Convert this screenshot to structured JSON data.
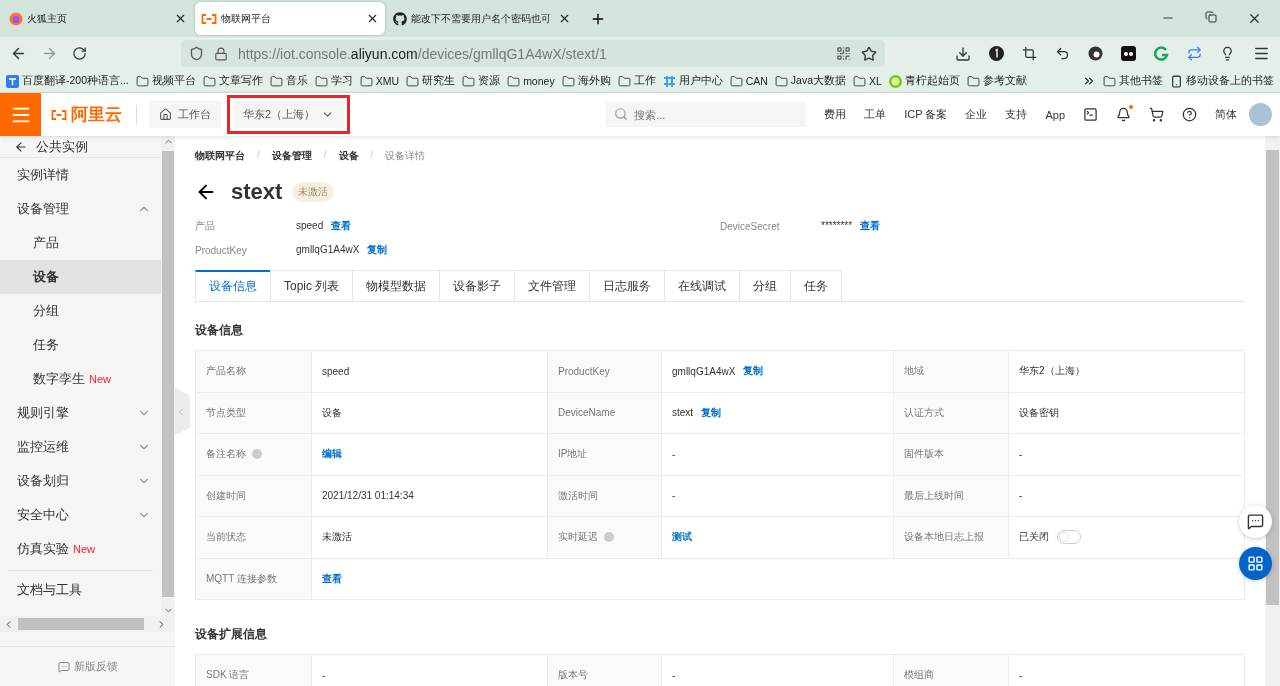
{
  "browser": {
    "tabs": [
      {
        "title": "火狐主页",
        "selected": false,
        "kind": "firefox"
      },
      {
        "title": "物联网平台",
        "selected": true,
        "kind": "aliyun"
      },
      {
        "title": "能改下不需要用户名个密码也可",
        "selected": false,
        "kind": "github"
      }
    ],
    "url": {
      "prefix": "https://iot.console.",
      "domain": "aliyun.com",
      "path": "/devices/gmllqG1A4wX/stext/1"
    },
    "bookmarks": [
      {
        "label": "百度翻译-200种语言...",
        "kind": "translate"
      },
      {
        "label": "视频平台",
        "kind": "folder"
      },
      {
        "label": "文章写作",
        "kind": "folder"
      },
      {
        "label": "音乐",
        "kind": "folder"
      },
      {
        "label": "学习",
        "kind": "folder"
      },
      {
        "label": "XMU",
        "kind": "folder"
      },
      {
        "label": "研究生",
        "kind": "folder"
      },
      {
        "label": "资源",
        "kind": "folder"
      },
      {
        "label": "money",
        "kind": "folder"
      },
      {
        "label": "海外购",
        "kind": "folder"
      },
      {
        "label": "工作",
        "kind": "folder"
      },
      {
        "label": "用户中心",
        "kind": "yan"
      },
      {
        "label": "CAN",
        "kind": "folder"
      },
      {
        "label": "Java大数据",
        "kind": "folder"
      },
      {
        "label": "XL",
        "kind": "folder"
      },
      {
        "label": "青柠起始页",
        "kind": "lime"
      },
      {
        "label": "参考文献",
        "kind": "folder"
      }
    ],
    "other_bookmarks": [
      {
        "label": "其他书签",
        "kind": "folder"
      },
      {
        "label": "移动设备上的书签",
        "kind": "phone"
      }
    ]
  },
  "header": {
    "brand": "阿里云",
    "workbench": "工作台",
    "region": "华东2（上海）",
    "region_highlighted": true,
    "search_placeholder": "搜索...",
    "nav": [
      "费用",
      "工单",
      "ICP 备案",
      "企业",
      "支持",
      "App"
    ],
    "notification_dot": true,
    "language": "简体"
  },
  "sidebar": {
    "back_item": "公共实例",
    "items": [
      {
        "label": "实例详情",
        "selected": false
      },
      {
        "label": "设备管理",
        "selected": false,
        "expanded": true,
        "children": [
          {
            "label": "产品",
            "selected": false
          },
          {
            "label": "设备",
            "selected": true
          },
          {
            "label": "分组",
            "selected": false
          },
          {
            "label": "任务",
            "selected": false
          },
          {
            "label": "数字孪生",
            "selected": false,
            "badge": "New"
          }
        ]
      },
      {
        "label": "规则引擎",
        "selected": false,
        "expanded": false
      },
      {
        "label": "监控运维",
        "selected": false,
        "expanded": false
      },
      {
        "label": "设备划归",
        "selected": false,
        "expanded": false
      },
      {
        "label": "安全中心",
        "selected": false,
        "expanded": false
      },
      {
        "label": "仿真实验",
        "selected": false,
        "badge": "New"
      }
    ],
    "footer_item": "文档与工具",
    "feedback": "新版反馈"
  },
  "breadcrumb": [
    "物联网平台",
    "设备管理",
    "设备",
    "设备详情"
  ],
  "breadcrumb_separator": "/",
  "title": "stext",
  "status_tag": "未激活",
  "summary": [
    [
      {
        "label": "产品",
        "value": "speed",
        "link": "查看"
      },
      {
        "label": "DeviceSecret",
        "masked_value": "********",
        "link": "查看"
      }
    ],
    [
      {
        "label": "ProductKey",
        "value": "gmllqG1A4wX",
        "link": "复制"
      }
    ]
  ],
  "tabs": [
    {
      "label": "设备信息",
      "selected": true
    },
    {
      "label": "Topic 列表",
      "selected": false
    },
    {
      "label": "物模型数据",
      "selected": false
    },
    {
      "label": "设备影子",
      "selected": false
    },
    {
      "label": "文件管理",
      "selected": false
    },
    {
      "label": "日志服务",
      "selected": false
    },
    {
      "label": "在线调试",
      "selected": false
    },
    {
      "label": "分组",
      "selected": false
    },
    {
      "label": "任务",
      "selected": false
    }
  ],
  "sections": [
    {
      "title": "设备信息",
      "rows": [
        [
          {
            "label": "产品名称",
            "kind": "text",
            "value": "speed"
          },
          {
            "label": "ProductKey",
            "kind": "text",
            "value": "gmllqG1A4wX",
            "link": "复制"
          },
          {
            "label": "地域",
            "kind": "text",
            "value": "华东2（上海）"
          }
        ],
        [
          {
            "label": "节点类型",
            "kind": "text",
            "value": "设备"
          },
          {
            "label": "DeviceName",
            "kind": "text",
            "value": "stext",
            "link": "复制"
          },
          {
            "label": "认证方式",
            "kind": "text",
            "value": "设备密钥"
          }
        ],
        [
          {
            "label": "备注名称",
            "help": true,
            "kind": "link",
            "link": "编辑"
          },
          {
            "label": "IP地址",
            "kind": "text",
            "value": "-"
          },
          {
            "label": "固件版本",
            "kind": "text",
            "value": "-"
          }
        ],
        [
          {
            "label": "创建时间",
            "kind": "text",
            "value": "2021/12/31 01:14:34"
          },
          {
            "label": "激活时间",
            "kind": "text",
            "value": "-"
          },
          {
            "label": "最后上线时间",
            "kind": "text",
            "value": "-"
          }
        ],
        [
          {
            "label": "当前状态",
            "kind": "text",
            "value": "未激活"
          },
          {
            "label": "实时延迟",
            "help": true,
            "kind": "link",
            "link": "测试"
          },
          {
            "label": "设备本地日志上报",
            "kind": "toggle",
            "value": "已关闭",
            "on": false
          }
        ],
        [
          {
            "label": "MQTT 连接参数",
            "kind": "link",
            "link": "查看"
          }
        ]
      ]
    },
    {
      "title": "设备扩展信息",
      "rows": [
        [
          {
            "label": "SDK 语言",
            "kind": "text",
            "value": "-"
          },
          {
            "label": "版本号",
            "kind": "text",
            "value": "-"
          },
          {
            "label": "模组商",
            "kind": "text",
            "value": "-"
          }
        ]
      ]
    }
  ]
}
